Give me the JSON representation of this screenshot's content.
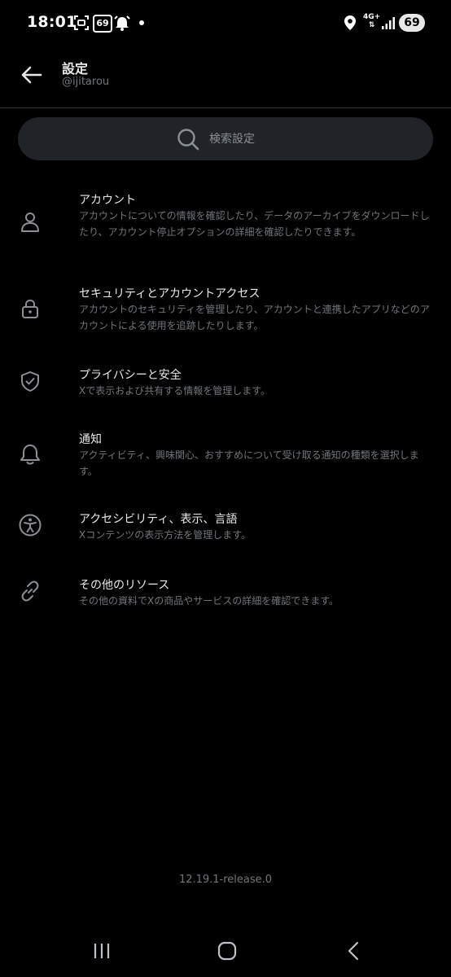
{
  "status_bar": {
    "time": "18:01",
    "notification_badge": "69",
    "network": "4G+",
    "battery": "69",
    "icons": [
      "screenshot-icon",
      "notification-badge-icon",
      "alarm-icon",
      "location-icon",
      "data-arrows-icon",
      "signal-icon",
      "battery-icon"
    ]
  },
  "header": {
    "title": "設定",
    "handle": "@ijitarou",
    "back_icon": "arrow-left-icon"
  },
  "search": {
    "placeholder": "検索設定",
    "icon": "search-icon"
  },
  "settings": [
    {
      "title": "アカウント",
      "description": "アカウントについての情報を確認したり、データのアーカイブをダウンロードしたり、アカウント停止オプションの詳細を確認したりできます。",
      "icon": "person-icon"
    },
    {
      "title": "セキュリティとアカウントアクセス",
      "description": "アカウントのセキュリティを管理したり、アカウントと連携したアプリなどのアカウントによる使用を追跡したりします。",
      "icon": "lock-icon"
    },
    {
      "title": "プライバシーと安全",
      "description": "Xで表示および共有する情報を管理します。",
      "icon": "shield-check-icon"
    },
    {
      "title": "通知",
      "description": "アクティビティ、興味関心、おすすめについて受け取る通知の種類を選択します。",
      "icon": "bell-icon"
    },
    {
      "title": "アクセシビリティ、表示、言語",
      "description": "Xコンテンツの表示方法を管理します。",
      "icon": "accessibility-icon"
    },
    {
      "title": "その他のリソース",
      "description": "その他の資料でXの商品やサービスの詳細を確認できます。",
      "icon": "link-icon"
    }
  ],
  "version": "12.19.1-release.0",
  "navbar": {
    "icons": [
      "recent-apps-icon",
      "home-icon",
      "back-icon"
    ]
  },
  "colors": {
    "background": "#000000",
    "text_primary": "#e7e9ea",
    "text_secondary": "#71767b",
    "search_bg": "#202327",
    "divider": "#2f3336"
  }
}
